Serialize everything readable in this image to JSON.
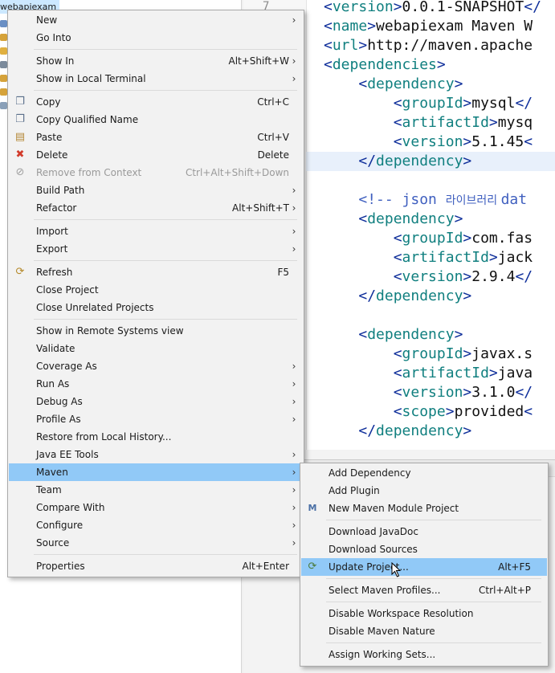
{
  "explorer": {
    "selected_project": "webapiexam"
  },
  "editor": {
    "line_number": "7",
    "lines": [
      {
        "parts": [
          {
            "cls": "b",
            "t": "<"
          },
          {
            "cls": "t",
            "t": "version"
          },
          {
            "cls": "b",
            "t": ">"
          },
          {
            "cls": "v",
            "t": "0.0.1-SNAPSHOT"
          },
          {
            "cls": "b",
            "t": "</"
          }
        ]
      },
      {
        "parts": [
          {
            "cls": "b",
            "t": "<"
          },
          {
            "cls": "t",
            "t": "name"
          },
          {
            "cls": "b",
            "t": ">"
          },
          {
            "cls": "v",
            "t": "webapiexam Maven W"
          }
        ]
      },
      {
        "parts": [
          {
            "cls": "b",
            "t": "<"
          },
          {
            "cls": "t",
            "t": "url"
          },
          {
            "cls": "b",
            "t": ">"
          },
          {
            "cls": "v",
            "t": "http://maven.apache"
          }
        ]
      },
      {
        "parts": [
          {
            "cls": "b",
            "t": "<"
          },
          {
            "cls": "t",
            "t": "dependencies"
          },
          {
            "cls": "b",
            "t": ">"
          }
        ]
      },
      {
        "parts": [
          {
            "cls": "v",
            "t": "    "
          },
          {
            "cls": "b",
            "t": "<"
          },
          {
            "cls": "t",
            "t": "dependency"
          },
          {
            "cls": "b",
            "t": ">"
          }
        ]
      },
      {
        "parts": [
          {
            "cls": "v",
            "t": "        "
          },
          {
            "cls": "b",
            "t": "<"
          },
          {
            "cls": "t",
            "t": "groupId"
          },
          {
            "cls": "b",
            "t": ">"
          },
          {
            "cls": "v",
            "t": "mysql"
          },
          {
            "cls": "b",
            "t": "</"
          }
        ]
      },
      {
        "parts": [
          {
            "cls": "v",
            "t": "        "
          },
          {
            "cls": "b",
            "t": "<"
          },
          {
            "cls": "t",
            "t": "artifactId"
          },
          {
            "cls": "b",
            "t": ">"
          },
          {
            "cls": "v",
            "t": "mysq"
          }
        ]
      },
      {
        "parts": [
          {
            "cls": "v",
            "t": "        "
          },
          {
            "cls": "b",
            "t": "<"
          },
          {
            "cls": "t",
            "t": "version"
          },
          {
            "cls": "b",
            "t": ">"
          },
          {
            "cls": "v",
            "t": "5.1.45"
          },
          {
            "cls": "b",
            "t": "<"
          }
        ]
      },
      {
        "parts": [
          {
            "cls": "v",
            "t": "    "
          },
          {
            "cls": "b",
            "t": "</"
          },
          {
            "cls": "t",
            "t": "dependency"
          },
          {
            "cls": "b",
            "t": ">"
          }
        ]
      },
      {
        "parts": []
      },
      {
        "parts": [
          {
            "cls": "v",
            "t": "    "
          },
          {
            "cls": "c",
            "t": "<!-- json "
          },
          {
            "cls": "ck",
            "t": "라이브러리 "
          },
          {
            "cls": "c",
            "t": "dat"
          }
        ]
      },
      {
        "parts": [
          {
            "cls": "v",
            "t": "    "
          },
          {
            "cls": "b",
            "t": "<"
          },
          {
            "cls": "t",
            "t": "dependency"
          },
          {
            "cls": "b",
            "t": ">"
          }
        ]
      },
      {
        "parts": [
          {
            "cls": "v",
            "t": "        "
          },
          {
            "cls": "b",
            "t": "<"
          },
          {
            "cls": "t",
            "t": "groupId"
          },
          {
            "cls": "b",
            "t": ">"
          },
          {
            "cls": "v",
            "t": "com.fas"
          }
        ]
      },
      {
        "parts": [
          {
            "cls": "v",
            "t": "        "
          },
          {
            "cls": "b",
            "t": "<"
          },
          {
            "cls": "t",
            "t": "artifactId"
          },
          {
            "cls": "b",
            "t": ">"
          },
          {
            "cls": "v",
            "t": "jack"
          }
        ]
      },
      {
        "parts": [
          {
            "cls": "v",
            "t": "        "
          },
          {
            "cls": "b",
            "t": "<"
          },
          {
            "cls": "t",
            "t": "version"
          },
          {
            "cls": "b",
            "t": ">"
          },
          {
            "cls": "v",
            "t": "2.9.4"
          },
          {
            "cls": "b",
            "t": "</"
          }
        ]
      },
      {
        "parts": [
          {
            "cls": "v",
            "t": "    "
          },
          {
            "cls": "b",
            "t": "</"
          },
          {
            "cls": "t",
            "t": "dependency"
          },
          {
            "cls": "b",
            "t": ">"
          }
        ]
      },
      {
        "parts": []
      },
      {
        "parts": [
          {
            "cls": "v",
            "t": "    "
          },
          {
            "cls": "b",
            "t": "<"
          },
          {
            "cls": "t",
            "t": "dependency"
          },
          {
            "cls": "b",
            "t": ">"
          }
        ]
      },
      {
        "parts": [
          {
            "cls": "v",
            "t": "        "
          },
          {
            "cls": "b",
            "t": "<"
          },
          {
            "cls": "t",
            "t": "groupId"
          },
          {
            "cls": "b",
            "t": ">"
          },
          {
            "cls": "v",
            "t": "javax.s"
          }
        ]
      },
      {
        "parts": [
          {
            "cls": "v",
            "t": "        "
          },
          {
            "cls": "b",
            "t": "<"
          },
          {
            "cls": "t",
            "t": "artifactId"
          },
          {
            "cls": "b",
            "t": ">"
          },
          {
            "cls": "v",
            "t": "java"
          }
        ]
      },
      {
        "parts": [
          {
            "cls": "v",
            "t": "        "
          },
          {
            "cls": "b",
            "t": "<"
          },
          {
            "cls": "t",
            "t": "version"
          },
          {
            "cls": "b",
            "t": ">"
          },
          {
            "cls": "v",
            "t": "3.1.0"
          },
          {
            "cls": "b",
            "t": "</"
          }
        ]
      },
      {
        "parts": [
          {
            "cls": "v",
            "t": "        "
          },
          {
            "cls": "b",
            "t": "<"
          },
          {
            "cls": "t",
            "t": "scope"
          },
          {
            "cls": "b",
            "t": ">"
          },
          {
            "cls": "v",
            "t": "provided"
          },
          {
            "cls": "b",
            "t": "<"
          }
        ]
      },
      {
        "parts": [
          {
            "cls": "v",
            "t": "    "
          },
          {
            "cls": "b",
            "t": "</"
          },
          {
            "cls": "t",
            "t": "dependency"
          },
          {
            "cls": "b",
            "t": ">"
          }
        ]
      }
    ]
  },
  "context_menu": {
    "items": [
      {
        "type": "item",
        "label": "New",
        "submenu": true
      },
      {
        "type": "item",
        "label": "Go Into"
      },
      {
        "type": "sep"
      },
      {
        "type": "item",
        "label": "Show In",
        "shortcut": "Alt+Shift+W",
        "submenu": true
      },
      {
        "type": "item",
        "label": "Show in Local Terminal",
        "submenu": true
      },
      {
        "type": "sep"
      },
      {
        "type": "item",
        "label": "Copy",
        "shortcut": "Ctrl+C",
        "icon": "copy-icon"
      },
      {
        "type": "item",
        "label": "Copy Qualified Name",
        "icon": "copy-qualified-name-icon"
      },
      {
        "type": "item",
        "label": "Paste",
        "shortcut": "Ctrl+V",
        "icon": "paste-icon"
      },
      {
        "type": "item",
        "label": "Delete",
        "shortcut": "Delete",
        "icon": "delete-icon"
      },
      {
        "type": "item",
        "label": "Remove from Context",
        "shortcut": "Ctrl+Alt+Shift+Down",
        "icon": "remove-context-icon",
        "disabled": true
      },
      {
        "type": "item",
        "label": "Build Path",
        "submenu": true
      },
      {
        "type": "item",
        "label": "Refactor",
        "shortcut": "Alt+Shift+T",
        "submenu": true
      },
      {
        "type": "sep"
      },
      {
        "type": "item",
        "label": "Import",
        "submenu": true
      },
      {
        "type": "item",
        "label": "Export",
        "submenu": true
      },
      {
        "type": "sep"
      },
      {
        "type": "item",
        "label": "Refresh",
        "shortcut": "F5",
        "icon": "refresh-icon"
      },
      {
        "type": "item",
        "label": "Close Project"
      },
      {
        "type": "item",
        "label": "Close Unrelated Projects"
      },
      {
        "type": "sep"
      },
      {
        "type": "item",
        "label": "Show in Remote Systems view"
      },
      {
        "type": "item",
        "label": "Validate"
      },
      {
        "type": "item",
        "label": "Coverage As",
        "submenu": true
      },
      {
        "type": "item",
        "label": "Run As",
        "submenu": true
      },
      {
        "type": "item",
        "label": "Debug As",
        "submenu": true
      },
      {
        "type": "item",
        "label": "Profile As",
        "submenu": true
      },
      {
        "type": "item",
        "label": "Restore from Local History..."
      },
      {
        "type": "item",
        "label": "Java EE Tools",
        "submenu": true
      },
      {
        "type": "item",
        "label": "Maven",
        "submenu": true,
        "selected": true
      },
      {
        "type": "item",
        "label": "Team",
        "submenu": true
      },
      {
        "type": "item",
        "label": "Compare With",
        "submenu": true
      },
      {
        "type": "item",
        "label": "Configure",
        "submenu": true
      },
      {
        "type": "item",
        "label": "Source",
        "submenu": true
      },
      {
        "type": "sep"
      },
      {
        "type": "item",
        "label": "Properties",
        "shortcut": "Alt+Enter"
      }
    ]
  },
  "maven_submenu": {
    "items": [
      {
        "type": "item",
        "label": "Add Dependency"
      },
      {
        "type": "item",
        "label": "Add Plugin"
      },
      {
        "type": "item",
        "label": "New Maven Module Project",
        "icon": "maven-module-icon"
      },
      {
        "type": "sep"
      },
      {
        "type": "item",
        "label": "Download JavaDoc"
      },
      {
        "type": "item",
        "label": "Download Sources"
      },
      {
        "type": "item",
        "label": "Update Project...",
        "shortcut": "Alt+F5",
        "icon": "update-project-icon",
        "selected": true
      },
      {
        "type": "sep"
      },
      {
        "type": "item",
        "label": "Select Maven Profiles...",
        "shortcut": "Ctrl+Alt+P"
      },
      {
        "type": "sep"
      },
      {
        "type": "item",
        "label": "Disable Workspace Resolution"
      },
      {
        "type": "item",
        "label": "Disable Maven Nature"
      },
      {
        "type": "sep"
      },
      {
        "type": "item",
        "label": "Assign Working Sets..."
      }
    ]
  },
  "colors": {
    "selection": "#91c9f7",
    "menu_bg": "#f2f2f2",
    "xml_tag": "#107f7f",
    "xml_bracket": "#0e2e9a",
    "comment": "#3f5fbf"
  }
}
